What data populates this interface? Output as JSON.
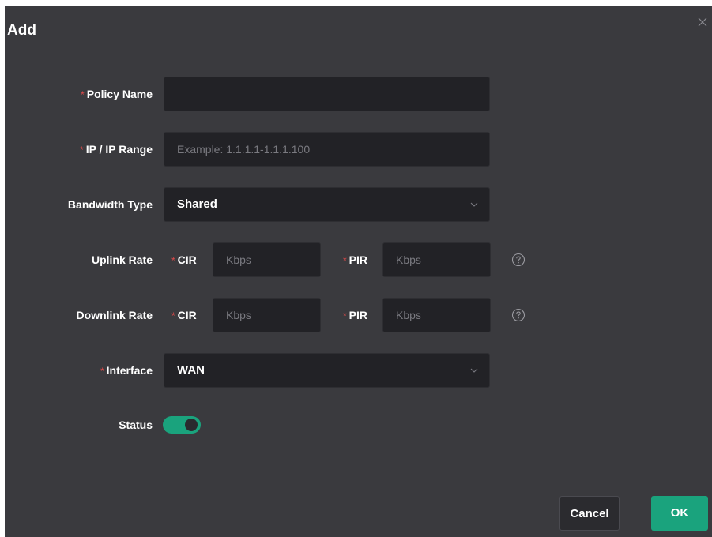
{
  "dialog": {
    "title": "Add"
  },
  "form": {
    "policy_name": {
      "label": "Policy Name",
      "value": "",
      "placeholder": ""
    },
    "ip_range": {
      "label": "IP / IP Range",
      "value": "",
      "placeholder": "Example: 1.1.1.1-1.1.1.100"
    },
    "bandwidth_type": {
      "label": "Bandwidth Type",
      "value": "Shared"
    },
    "uplink_rate": {
      "label": "Uplink Rate",
      "cir_label": "CIR",
      "cir_placeholder": "Kbps",
      "pir_label": "PIR",
      "pir_placeholder": "Kbps"
    },
    "downlink_rate": {
      "label": "Downlink Rate",
      "cir_label": "CIR",
      "cir_placeholder": "Kbps",
      "pir_label": "PIR",
      "pir_placeholder": "Kbps"
    },
    "interface": {
      "label": "Interface",
      "value": "WAN"
    },
    "status": {
      "label": "Status",
      "enabled": true
    }
  },
  "footer": {
    "cancel_label": "Cancel",
    "ok_label": "OK"
  },
  "icons": {
    "close": "close-icon",
    "help": "question-circle-icon",
    "chevron": "chevron-down-icon"
  },
  "colors": {
    "accent": "#1aa37d",
    "required": "#e04a4a",
    "dialog_bg": "#3a3a3e",
    "input_bg": "#222226"
  }
}
